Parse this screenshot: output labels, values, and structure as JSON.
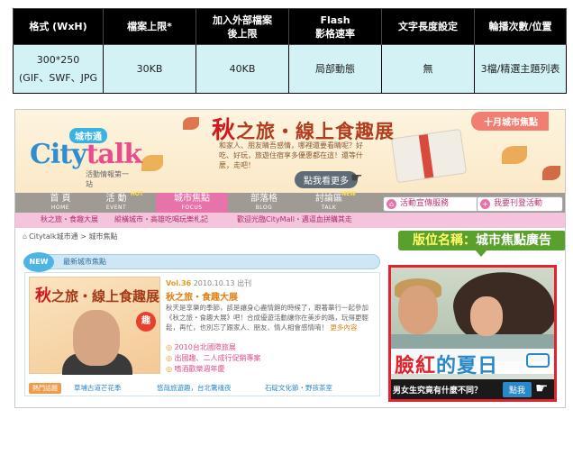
{
  "spec_table": {
    "headers": [
      "格式 (WxH)",
      "檔案上限*",
      "加入外部檔案後上限",
      "Flash影格速率",
      "文字長度設定",
      "輪播次數/位置"
    ],
    "header_lines": [
      [
        "格式 (WxH)"
      ],
      [
        "檔案上限*"
      ],
      [
        "加入外部檔案",
        "後上限"
      ],
      [
        "Flash",
        "影格速率"
      ],
      [
        "文字長度設定"
      ],
      [
        "輪播次數/位置"
      ]
    ],
    "row": {
      "format_size": "300*250",
      "format_types": "(GIF、SWF、JPG",
      "file_limit": "30KB",
      "external_limit": "40KB",
      "flash_fps": "局部動態",
      "text_length": "無",
      "rotation": "3檔/精選主題列表"
    }
  },
  "site": {
    "logo": {
      "tag": "城市通",
      "name_a": "City",
      "name_b": "talk",
      "sub": "活動情報第一站"
    },
    "banner": {
      "headline_em": "秋",
      "headline": "之旅・線上食趣展",
      "desc": "和家人、朋友睛吾感情，哪裡還要看睛呢？好吃、好玩，旅遊住宿享多優惠都在這！還等什麼，走吧！",
      "cta": "點我看更多",
      "topic_tab": "十月城市焦點"
    },
    "nav": [
      {
        "zh": "首 頁",
        "en": "HOME",
        "badge": ""
      },
      {
        "zh": "活 動",
        "en": "EVENT",
        "badge": "HOT"
      },
      {
        "zh": "城市焦點",
        "en": "FOCUS",
        "badge": ""
      },
      {
        "zh": "部落格",
        "en": "BLOG",
        "badge": ""
      },
      {
        "zh": "討論區",
        "en": "TALK",
        "badge": "NEW"
      }
    ],
    "nav_buttons": {
      "promo": "活動宣傳服務",
      "register": "我要刊登活動"
    },
    "subnav": [
      "秋之旅・食趣大展",
      "縱橫城市・高雄吃喝玩樂札記",
      "歡迎光臨CityMall・邁逼血拼購其走"
    ],
    "breadcrumb": "Citytalk城市通 > 城市焦點",
    "section": {
      "badge": "NEW",
      "title": "最新城市焦點"
    },
    "news": {
      "thumb_em": "秋",
      "thumb_title": "之旅・線上食趣展",
      "thumb_stamp": "趣",
      "vol_no": "Vol.36",
      "vol_date": "2010.10.13 出刊",
      "title": "秋之旅・食趣大展",
      "body": "秋天是享樂的季節，該是讓身心盡情飽的時候了，跟著華行一起參加《秋之旅・食趣大展》吧！合成優遊活動讓你在美步的路，玩得更輕鬆，再忙，也別忘了跟家人、朋友、情人相會感情唷！",
      "more": "更多內容",
      "links": [
        "2010台北國際旅展",
        "出國趣、二人成行促銷專案",
        "嗜酒歡樂週年慶"
      ],
      "tag_label": "熱門話題",
      "tags": [
        "草埔古道芒花季",
        "悠哉旅遊趣，台北驚魂夜",
        "石碇文化節・野孩茶室"
      ]
    },
    "ad_slot": {
      "label_prefix": "版位名稱：",
      "label": "城市焦點廣告",
      "ad_title_a": "臉",
      "ad_title_b": "紅",
      "ad_title_c": "的夏日",
      "ad_question": "男女生究竟有什麼不同？",
      "ad_button": "點我"
    }
  },
  "colors": {
    "header_bg": "#000000",
    "cell_bg": "#d3f2f6",
    "nav_bg": "#a09a94",
    "nav_active": "#e773ab",
    "slot_green": "#5aa02c",
    "slot_border": "#e0242f"
  }
}
